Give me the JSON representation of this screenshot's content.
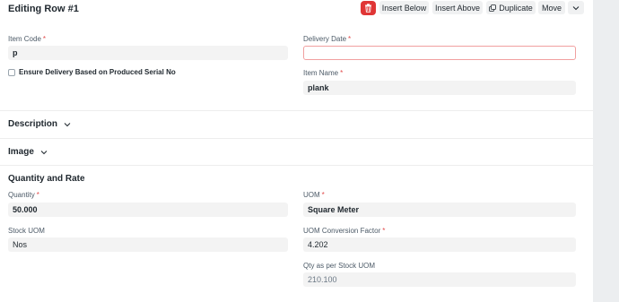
{
  "header": {
    "title": "Editing Row #1",
    "buttons": {
      "insert_below": "Insert Below",
      "insert_above": "Insert Above",
      "duplicate": "Duplicate",
      "move": "Move"
    }
  },
  "fields": {
    "item_code": {
      "label": "Item Code",
      "value": "p"
    },
    "delivery_date": {
      "label": "Delivery Date",
      "value": ""
    },
    "ensure_delivery": {
      "label": "Ensure Delivery Based on Produced Serial No",
      "checked": false
    },
    "item_name": {
      "label": "Item Name",
      "value": "plank"
    }
  },
  "sections": {
    "description": "Description",
    "image": "Image",
    "quantity_rate": "Quantity and Rate"
  },
  "qty_fields": {
    "quantity": {
      "label": "Quantity",
      "value": "50.000"
    },
    "uom": {
      "label": "UOM",
      "value": "Square Meter"
    },
    "stock_uom": {
      "label": "Stock UOM",
      "value": "Nos"
    },
    "conversion_factor": {
      "label": "UOM Conversion Factor",
      "value": "4.202"
    },
    "stock_qty": {
      "label": "Qty as per Stock UOM",
      "value": "210.100"
    }
  },
  "required_mark": "*",
  "colors": {
    "danger": "#e03636",
    "required": "#e24c4c",
    "error_border": "#f1a0a0",
    "field_bg": "#f3f3f3"
  },
  "icons": [
    "trash-icon",
    "duplicate-icon",
    "chevron-down-icon"
  ]
}
